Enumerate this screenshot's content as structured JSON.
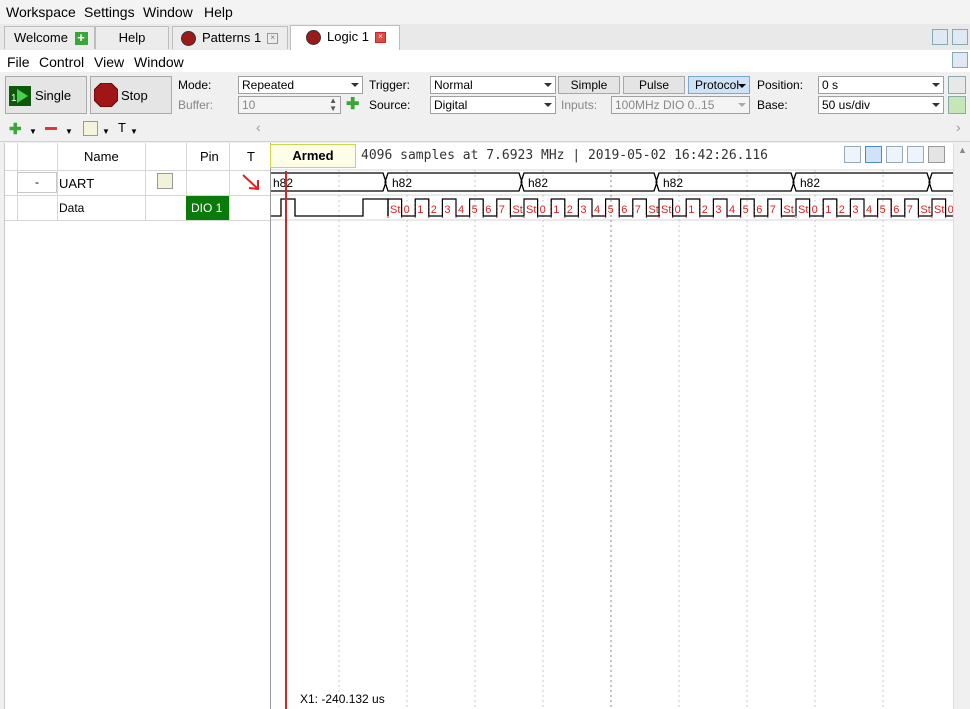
{
  "top_menu": [
    "Workspace",
    "Settings",
    "Window",
    "Help"
  ],
  "tabs": [
    {
      "label": "Welcome"
    },
    {
      "label": "Help"
    },
    {
      "label": "Patterns 1"
    },
    {
      "label": "Logic 1"
    }
  ],
  "menu2": [
    "File",
    "Control",
    "View",
    "Window"
  ],
  "controls": {
    "single_label": "Single",
    "stop_label": "Stop",
    "mode_label": "Mode:",
    "mode_value": "Repeated",
    "buffer_label": "Buffer:",
    "buffer_value": "10",
    "trigger_label": "Trigger:",
    "trigger_value": "Normal",
    "source_label": "Source:",
    "source_value": "Digital",
    "simple_label": "Simple",
    "pulse_label": "Pulse",
    "protocol_label": "Protocol",
    "inputs_label": "Inputs:",
    "inputs_value": "100MHz DIO 0..15",
    "position_label": "Position:",
    "position_value": "0 s",
    "base_label": "Base:",
    "base_value": "50 us/div"
  },
  "toolbar3": {
    "t_label": "T"
  },
  "grid": {
    "headers": {
      "name": "Name",
      "pin": "Pin",
      "t": "T"
    },
    "rows": [
      {
        "collapse": "-",
        "name": "UART"
      },
      {
        "name": "Data",
        "pin": "DIO  1"
      }
    ]
  },
  "scope": {
    "status": "Armed",
    "info": "4096 samples at 7.6923 MHz | 2019-05-02 16:42:26.116",
    "cursor_label": "X1: -240.132 us",
    "bus_labels": [
      "h82",
      "h82",
      "h82",
      "h82",
      "h82"
    ],
    "bit_labels": [
      "St",
      "0",
      "1",
      "2",
      "3",
      "4",
      "5",
      "6",
      "7",
      "St"
    ]
  },
  "colors": {
    "trigger_arrow": "#e02020",
    "pin_bg": "#0a7a0a",
    "cursor": "#e02020",
    "decode": "#e02020"
  }
}
